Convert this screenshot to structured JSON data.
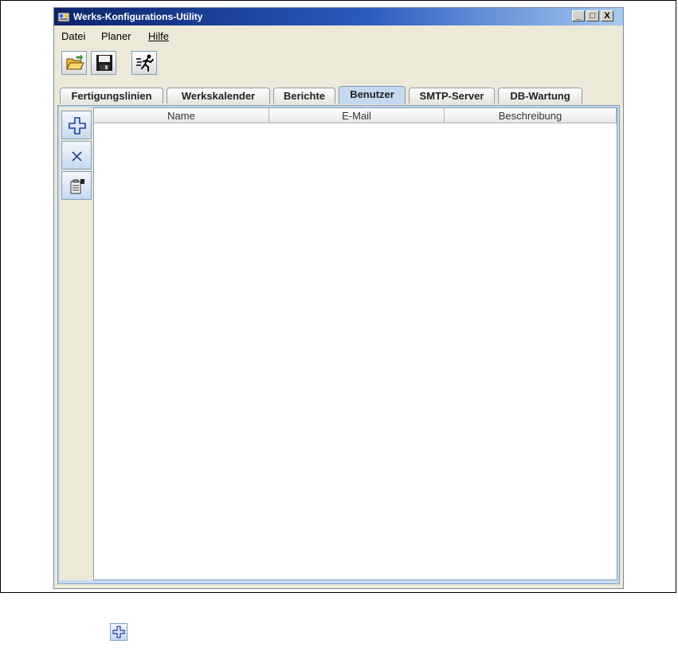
{
  "window": {
    "title": "Werks-Konfigurations-Utility",
    "controls": {
      "minimize": "_",
      "maximize": "□",
      "close": "X"
    }
  },
  "menu": [
    "Datei",
    "Planer",
    "Hilfe"
  ],
  "toolbar": {
    "icons": [
      "open-folder-icon",
      "save-disk-icon",
      "run-man-icon"
    ]
  },
  "tabs": [
    "Fertigungslinien",
    "Werkskalender",
    "Berichte",
    "Benutzer",
    "SMTP-Server",
    "DB-Wartung"
  ],
  "active_tab": "Benutzer",
  "sidebar": {
    "icons": [
      "add-plus-icon",
      "delete-x-icon",
      "properties-icon"
    ]
  },
  "table": {
    "columns": [
      "Name",
      "E-Mail",
      "Beschreibung"
    ],
    "rows": []
  },
  "colors": {
    "titlebar": "#0a246a",
    "active_tab": "#c6d9f0",
    "border": "#7f9db9"
  }
}
